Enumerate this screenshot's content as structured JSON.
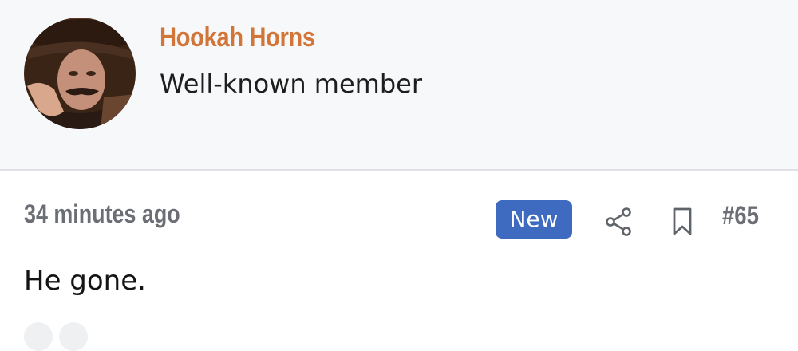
{
  "user": {
    "name": "Hookah Horns",
    "title": "Well-known member"
  },
  "post": {
    "time": "34 minutes ago",
    "badge": "New",
    "number": "#65",
    "body": "He gone."
  },
  "icons": {
    "share": "share-icon",
    "bookmark": "bookmark-icon"
  },
  "colors": {
    "username": "#d27538",
    "badge": "#3e6bbf",
    "meta": "#6b6e74",
    "header_bg": "#f7f8f9"
  }
}
